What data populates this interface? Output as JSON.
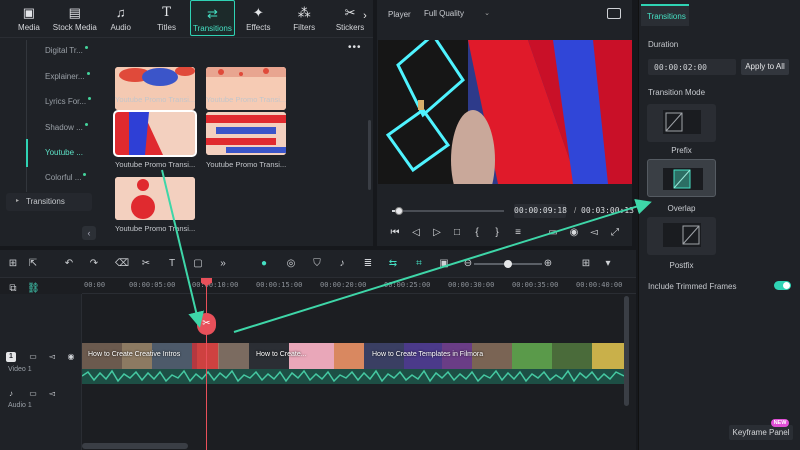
{
  "toolbar": {
    "tabs": [
      {
        "label": "Media",
        "icon": "media-icon"
      },
      {
        "label": "Stock Media",
        "icon": "stock-media-icon"
      },
      {
        "label": "Audio",
        "icon": "audio-icon"
      },
      {
        "label": "Titles",
        "icon": "titles-icon"
      },
      {
        "label": "Transitions",
        "icon": "transitions-icon",
        "active": true
      },
      {
        "label": "Effects",
        "icon": "effects-icon"
      },
      {
        "label": "Filters",
        "icon": "filters-icon"
      },
      {
        "label": "Stickers",
        "icon": "stickers-icon"
      }
    ],
    "more_icon": "chevron-right-icon"
  },
  "sidebar": {
    "items": [
      {
        "label": "Digital Tr...",
        "dot": true
      },
      {
        "label": "Explainer...",
        "dot": true
      },
      {
        "label": "Lyrics For...",
        "dot": true
      },
      {
        "label": "Shadow ...",
        "dot": true
      },
      {
        "label": "Youtube ...",
        "dot": false,
        "active": true
      },
      {
        "label": "Colorful ...",
        "dot": true
      }
    ],
    "root": "Transitions"
  },
  "library": {
    "items": [
      {
        "label": "Youtube Promo Transi..."
      },
      {
        "label": "Youtube Promo Transi..."
      },
      {
        "label": "Youtube Promo Transi...",
        "selected": true
      },
      {
        "label": "Youtube Promo Transi..."
      },
      {
        "label": "Youtube Promo Transi..."
      }
    ]
  },
  "player": {
    "label": "Player",
    "quality": "Full Quality",
    "time_current": "00:00:09:18",
    "time_separator": "/",
    "time_total": "00:03:00:13",
    "progress": 0.05
  },
  "props": {
    "tab": "Transitions",
    "duration_label": "Duration",
    "duration_value": "00:00:02:00",
    "apply_all": "Apply to All",
    "mode_label": "Transition Mode",
    "modes": [
      "Prefix",
      "Overlap",
      "Postfix"
    ],
    "active_mode": "Overlap",
    "include_trimmed": "Include Trimmed Frames",
    "include_trimmed_on": true,
    "keyframe_panel": "Keyframe Panel",
    "new_badge": "NEW"
  },
  "timeline": {
    "ticks": [
      "00:00",
      "00:00:05:00",
      "00:00:10:00",
      "00:00:15:00",
      "00:00:20:00",
      "00:00:25:00",
      "00:00:30:00",
      "00:00:35:00",
      "00:00:40:00"
    ],
    "video_track": {
      "badge": "1",
      "label": "Video 1"
    },
    "audio_track": {
      "badge": "1",
      "label": "Audio 1"
    },
    "clip_titles": [
      "How to Create Creative Intros",
      "How to Create...",
      "How to Create Templates in Filmora"
    ],
    "playhead_time": "00:00:10:00"
  },
  "colors": {
    "accent": "#2fd3b4",
    "playhead": "#e8505a",
    "arrow": "#3ed6a8"
  }
}
